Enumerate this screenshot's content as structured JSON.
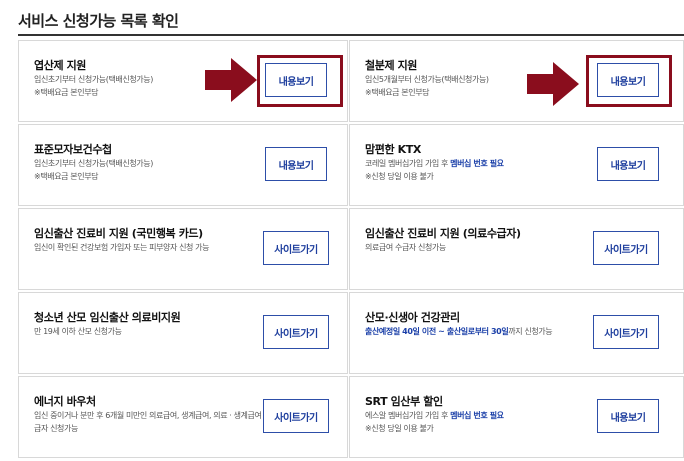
{
  "page": {
    "title": "서비스 신청가능 목록 확인"
  },
  "cards": [
    {
      "title": "엽산제 지원",
      "desc": [
        "임신초기부터 신청가능(택배신청가능)",
        "※택배요금 본인부담"
      ],
      "button": "내용보기"
    },
    {
      "title": "철분제 지원",
      "desc": [
        "임신5개월부터 신청가능(택배신청가능)",
        "※택배요금 본인부담"
      ],
      "button": "내용보기"
    },
    {
      "title": "표준모자보건수첩",
      "desc": [
        "임신초기부터 신청가능(택배신청가능)",
        "※택배요금 본인부담"
      ],
      "button": "내용보기"
    },
    {
      "title": "맘편한 KTX",
      "desc_parts": {
        "pre": "코레일 멤버십가입 가입 후 ",
        "highlight": "멤버십 번호 필요",
        "post": ""
      },
      "desc2": "※신청 당일 이용 불가",
      "button": "내용보기"
    },
    {
      "title": "임신출산 진료비 지원 (국민행복 카드)",
      "desc": [
        "임신이 확인된 건강보험 가입자 또는 피부양자 신청 가능"
      ],
      "button": "사이트가기"
    },
    {
      "title": "임신출산 진료비 지원 (의료수급자)",
      "desc": [
        "의료급여 수급자 신청가능"
      ],
      "button": "사이트가기"
    },
    {
      "title": "청소년 산모 임신출산 의료비지원",
      "desc": [
        "만 19세 이하 산모 신청가능"
      ],
      "button": "사이트가기"
    },
    {
      "title": "산모·신생아 건강관리",
      "desc_parts": {
        "pre": "",
        "highlight": "출산예정일 40일 이전 ~ 출산일로부터 30일",
        "post": "까지 신청가능"
      },
      "button": "사이트가기"
    },
    {
      "title": "에너지 바우처",
      "desc": [
        "임신 중이거나 분만 후 6개월 미만인 의료급여, 생계급여, 의료 · 생계급여 수급자 신청가능"
      ],
      "button": "사이트가기"
    },
    {
      "title": "SRT 임산부 할인",
      "desc_parts": {
        "pre": "에스알 멤버십가입 가입 후 ",
        "highlight": "멤버십 번호 필요",
        "post": ""
      },
      "desc2": "※신청 당일 이용 불가",
      "button": "내용보기"
    }
  ],
  "colors": {
    "accent": "#8a0d1d",
    "button": "#2d4ea8",
    "highlight_text": "#1a3fa8"
  }
}
